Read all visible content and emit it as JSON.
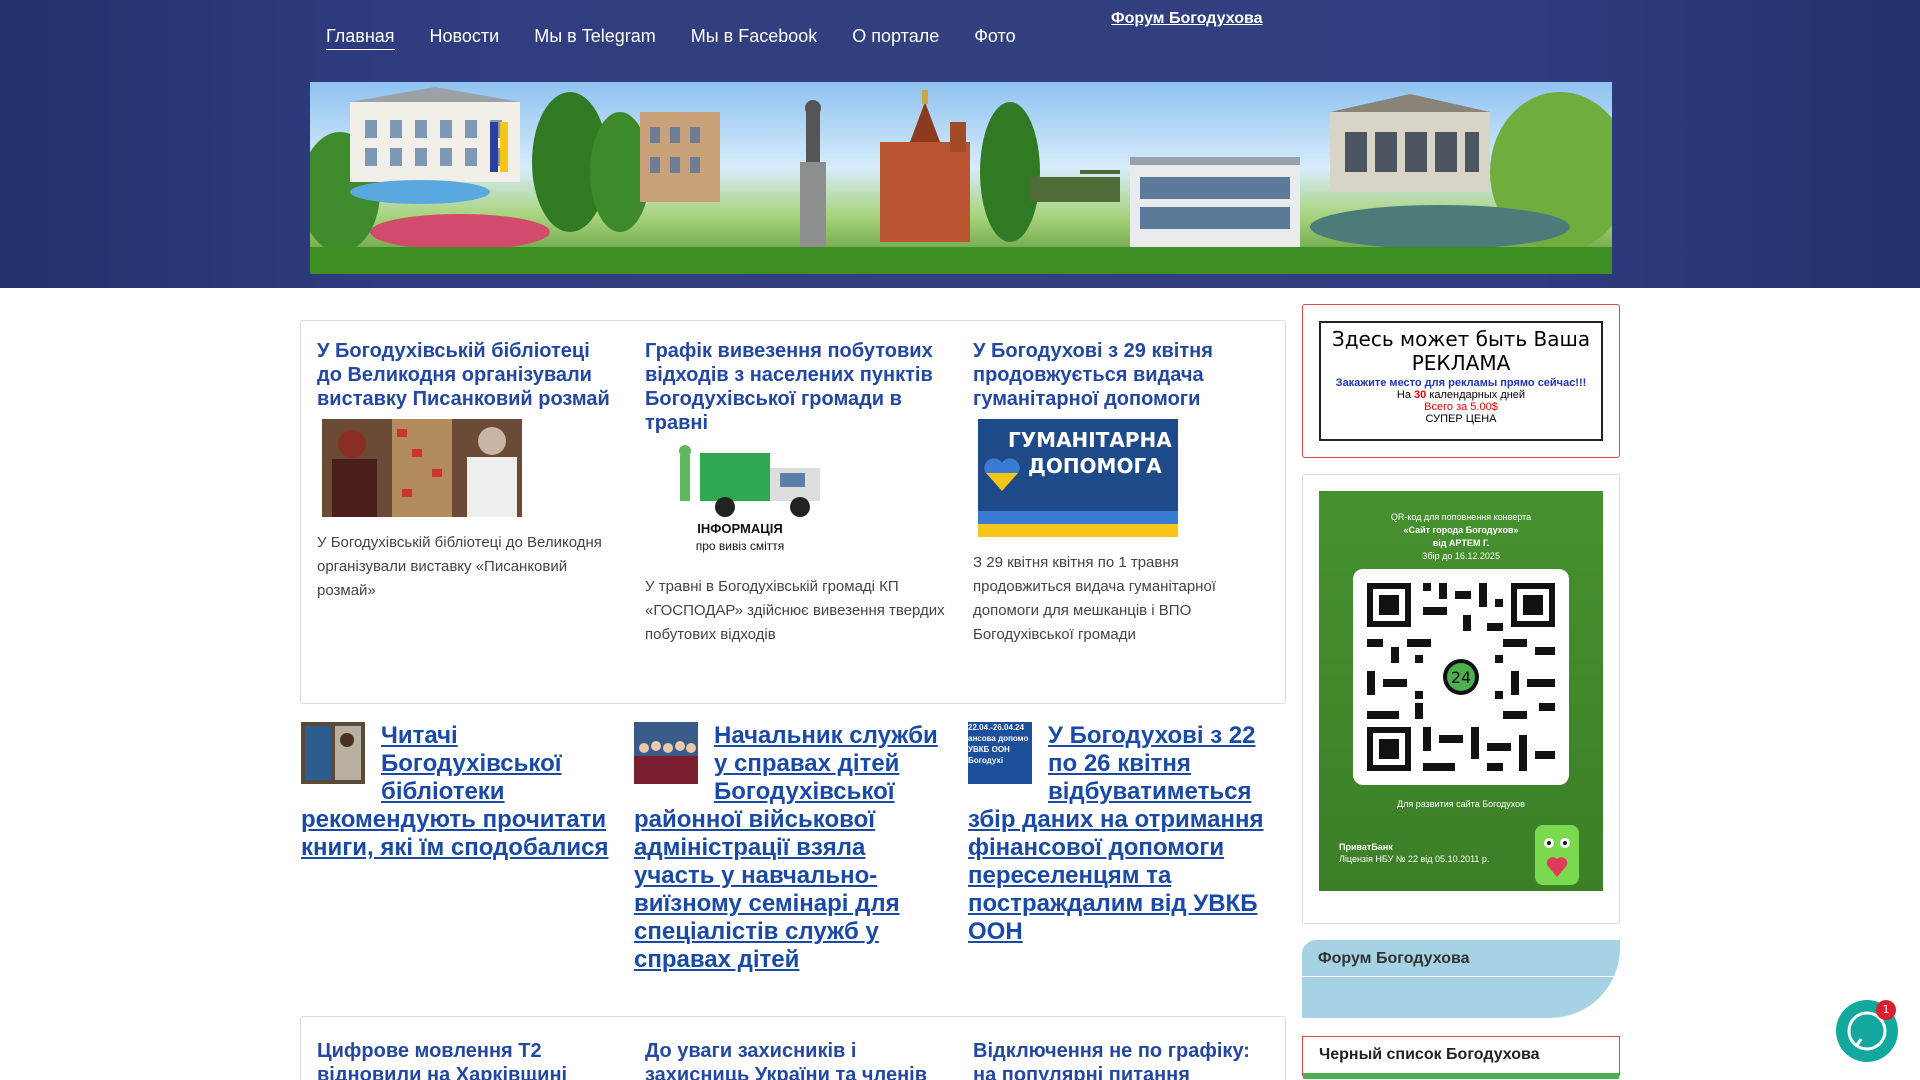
{
  "nav": {
    "items": [
      "Главная",
      "Новости",
      "Мы в Telegram",
      "Мы в Facebook",
      "О портале",
      "Фото"
    ],
    "forum_link": "Форум Богодухова"
  },
  "news_top": [
    {
      "title": "У Богодухівській бібліотеці до Великодня організували виставку Писанковий розмай",
      "excerpt": "У Богодухівській бібліотеці до Великодня організували виставку «Писанковий розмай»"
    },
    {
      "title": "Графік вивезення побутових відходів з населених пунктів Богодухівської громади в травні",
      "image_caption_1": "ІНФОРМАЦІЯ",
      "image_caption_2": "про вивіз сміття",
      "excerpt": "У травні в Богодухівській громаді КП «ГОСПОДАР» здійснює вивезення твердих побутових відходів"
    },
    {
      "title": "У Богодухові з 29 квітня продовжується видача гуманітарної допомоги",
      "image_caption_1": "ГУМАНІТАРНА",
      "image_caption_2": "ДОПОМОГА",
      "excerpt": "З 29 квітня квітня по 1 травня продовжиться видача гуманітарної допомоги для мешканців і ВПО Богодухівської громади"
    }
  ],
  "news_links": [
    "Читачі Богодухівської бібліотеки рекомендують прочитати книги, які їм сподобалися",
    "Начальник служби у справах дітей Богодухівської районної військової адміністрації взяла участь у навчально-виїзному семінарі для спеціалістів служб у справах дітей",
    "У Богодухові з 22 по 26 квітня відбуватиметься збір даних на отримання фінансової допомоги переселенцям та постраждалим від УВКБ ООН"
  ],
  "news_links_thumb3_text": "22.04.-26.04.24 ансова допомо УВКБ ООН Богодухі",
  "news_bottom": [
    "Цифрове мовлення Т2 відновили на Харківщині",
    "До уваги захисників і захисниць України та членів",
    "Відключення не по графіку: на популярні питання"
  ],
  "sidebar": {
    "ad": {
      "line1": "Здесь может быть Ваша",
      "line2": "РЕКЛАМА",
      "line3": "Закажите место для рекламы прямо сейчас!!!",
      "line4_pre": "На",
      "line4_num": "30",
      "line4_post": "календарных дней",
      "line5": "Всего за 5.00$",
      "line6": "СУПЕР ЦЕНА"
    },
    "qr": {
      "caption_1": "QR-код для поповнення конверта",
      "caption_2": "«Сайт города Богодухов»",
      "caption_3": "від АРТЕМ Г.",
      "caption_4": "Збір до 16.12.2025",
      "center_badge": "24",
      "purpose": "Для развития сайта Богодухов",
      "bank": "ПриватБанк",
      "license": "Ліцензія НБУ № 22 від 05.10.2011 р."
    },
    "forum_label": "Форум Богодухова",
    "blacklist_label": "Черный список Богодухова"
  },
  "chat": {
    "badge": "1"
  },
  "colors": {
    "header": "#2f3c80",
    "link": "#2347a3",
    "sidebar_forum": "#a6d3e3",
    "chat": "#13a89e",
    "badge": "#d9202f"
  }
}
